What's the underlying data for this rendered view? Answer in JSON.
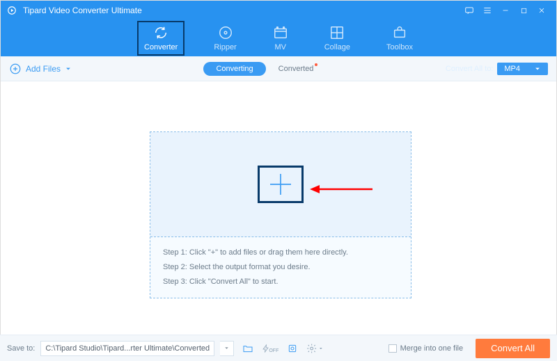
{
  "titlebar": {
    "title": "Tipard Video Converter Ultimate"
  },
  "tabs": [
    {
      "id": "converter",
      "label": "Converter",
      "active": true,
      "highlight": true
    },
    {
      "id": "ripper",
      "label": "Ripper"
    },
    {
      "id": "mv",
      "label": "MV"
    },
    {
      "id": "collage",
      "label": "Collage"
    },
    {
      "id": "toolbox",
      "label": "Toolbox"
    }
  ],
  "subbar": {
    "add_files_label": "Add Files",
    "converting_label": "Converting",
    "converted_label": "Converted",
    "convert_all_to_label": "Convert All to:",
    "format_value": "MP4"
  },
  "instructions": {
    "step1": "Step 1: Click \"+\" to add files or drag them here directly.",
    "step2": "Step 2: Select the output format you desire.",
    "step3": "Step 3: Click \"Convert All\" to start."
  },
  "footer": {
    "save_to_label": "Save to:",
    "save_path": "C:\\Tipard Studio\\Tipard...rter Ultimate\\Converted",
    "merge_label": "Merge into one file",
    "convert_all_button": "Convert All"
  },
  "annotation": {
    "arrow_color": "#ff0000",
    "highlight_color": "#083a6a"
  }
}
